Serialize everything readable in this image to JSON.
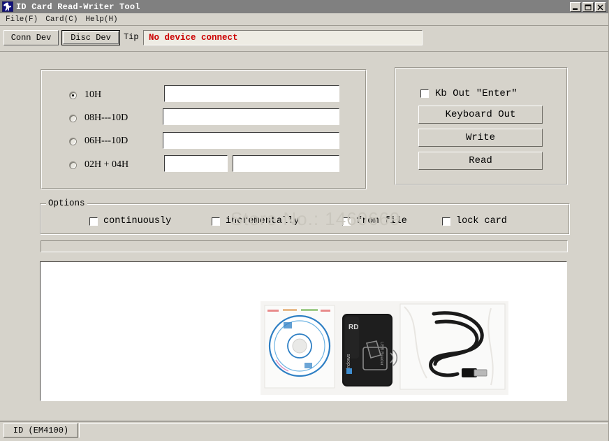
{
  "window": {
    "title": "ID Card Read-Writer Tool",
    "icon": "app-icon",
    "minimize_label": "_",
    "maximize_label": "□",
    "close_label": "×"
  },
  "menubar": {
    "items": [
      {
        "label": "File(F)"
      },
      {
        "label": "Card(C)"
      },
      {
        "label": "Help(H)"
      }
    ]
  },
  "toolbar": {
    "conn_dev_label": "Conn Dev",
    "disc_dev_label": "Disc Dev",
    "tip_label": "Tip",
    "tip_value": "No device connect",
    "tip_color": "#cc0000"
  },
  "format_group": {
    "options": [
      {
        "label": "10H",
        "checked": true,
        "value": ""
      },
      {
        "label": "08H---10D",
        "checked": false,
        "value": ""
      },
      {
        "label": "06H---10D",
        "checked": false,
        "value": ""
      },
      {
        "label": "02H + 04H",
        "checked": false,
        "value": "",
        "value2": ""
      }
    ]
  },
  "actions_group": {
    "kb_out_enter_label": "Kb Out \"Enter\"",
    "kb_out_enter_checked": false,
    "keyboard_out_label": "Keyboard Out",
    "write_label": "Write",
    "read_label": "Read"
  },
  "options_group": {
    "legend": "Options",
    "items": [
      {
        "label": "continuously",
        "checked": false
      },
      {
        "label": "incrementally",
        "checked": false
      },
      {
        "label": "from file",
        "checked": false
      },
      {
        "label": "lock card",
        "checked": false
      }
    ]
  },
  "progress": {
    "value": 0
  },
  "watermark": {
    "text": "Store No.: 1460669"
  },
  "statusbar": {
    "card_type": "ID (EM4100)"
  },
  "colors": {
    "window_background": "#d6d3cb",
    "titlebar": "#808080",
    "field_background": "#ffffff",
    "tip_field_background": "#eeece4",
    "error_text": "#cc0000"
  }
}
